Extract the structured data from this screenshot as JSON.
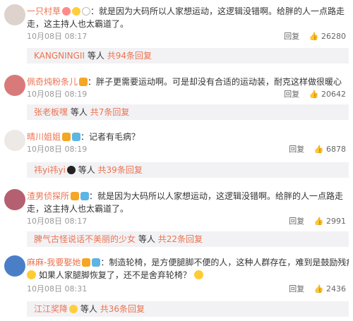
{
  "comments": [
    {
      "name": "一只村草",
      "text1": "：就是因为大码所以人家想运动，这逻辑没错啊。给胖的人一点路走",
      "text2": "走，这主持人也太霸道了。",
      "time": "10月08日 08:17",
      "reply_label": "回复",
      "likes": "26280",
      "thread_user": "KANGNINGII",
      "thread_text": "等人",
      "thread_more": "共94条回复"
    },
    {
      "name": "佩奇炖粉条儿",
      "text1": "：胖子更需要运动啊。可是却没有合适的运动装，耐克这样做很暖心",
      "time": "10月08日 08:19",
      "reply_label": "回复",
      "likes": "20642",
      "thread_user": "张老板嘿",
      "thread_text": "等人",
      "thread_more": "共7条回复"
    },
    {
      "name": "晴川姐姐",
      "text1": "：记者有毛病？",
      "time": "10月08日 08:19",
      "reply_label": "回复",
      "likes": "6878",
      "thread_user": "祎yi祎yi",
      "thread_text": "等人",
      "thread_more": "共39条回复"
    },
    {
      "name": "渣男侦探所",
      "text1": "：就是因为大码所以人家想运动，这逻辑没错啊。给胖的人一点路走",
      "text2": "走，这主持人也太霸道了。",
      "time": "10月08日 08:17",
      "reply_label": "回复",
      "likes": "2991",
      "thread_user": "脾气古怪说话不美丽的少女",
      "thread_text": "等人",
      "thread_more": "共22条回复"
    },
    {
      "name": "麻麻-我要娶她",
      "text1": "：制造轮椅，是方便腿脚不便的人，这种人群存在，难到是鼓励残疾？",
      "text2": "如果人家腿脚恢复了，还不是舍弃轮椅？",
      "time": "10月08日 08:31",
      "reply_label": "回复",
      "likes": "2436",
      "thread_user": "江江奖降",
      "thread_text": "等人",
      "thread_more": "共36条回复"
    }
  ]
}
